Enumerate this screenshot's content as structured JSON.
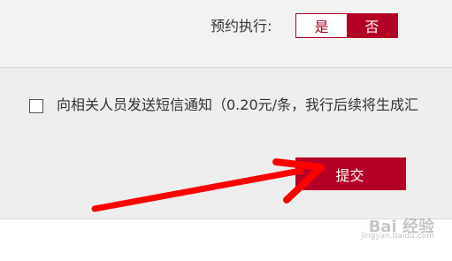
{
  "schedule": {
    "label": "预约执行:",
    "yes": "是",
    "no": "否",
    "selected": "否"
  },
  "sms": {
    "checked": false,
    "label": "向相关人员发送短信通知（0.20元/条，我行后续将生成汇"
  },
  "submit_label": "提交",
  "watermark": {
    "text": "Bai 经验",
    "sub": "jingyan.baidu.com"
  },
  "colors": {
    "accent": "#b40024",
    "annotation_arrow": "#ff0000"
  }
}
